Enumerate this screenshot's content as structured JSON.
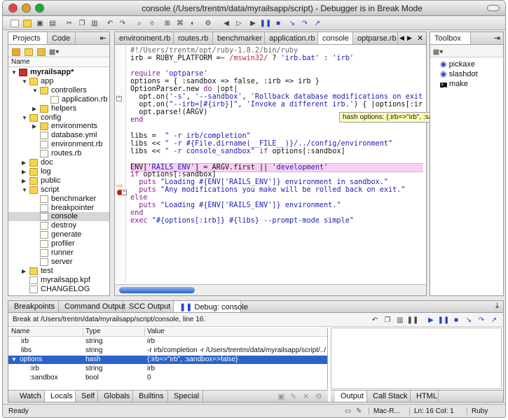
{
  "window": {
    "title": "console (/Users/trentm/data/myrailsapp/script) - Debugger is in Break Mode"
  },
  "colors": {
    "highlight_line": "#fbd0f5",
    "selection": "#2b63c9",
    "tooltip": "#ffffb8"
  },
  "left_panel": {
    "tabs": [
      "Projects",
      "Code"
    ],
    "column_header": "Name",
    "tree": [
      {
        "label": "myrailsapp*",
        "depth": 0,
        "type": "project",
        "expanded": true,
        "bold": true
      },
      {
        "label": "app",
        "depth": 1,
        "type": "folder",
        "expanded": true
      },
      {
        "label": "controllers",
        "depth": 2,
        "type": "folder",
        "expanded": true
      },
      {
        "label": "application.rb",
        "depth": 3,
        "type": "file"
      },
      {
        "label": "helpers",
        "depth": 2,
        "type": "folder",
        "expanded": false
      },
      {
        "label": "config",
        "depth": 1,
        "type": "folder",
        "expanded": true
      },
      {
        "label": "environments",
        "depth": 2,
        "type": "folder",
        "expanded": false
      },
      {
        "label": "database.yml",
        "depth": 2,
        "type": "file"
      },
      {
        "label": "environment.rb",
        "depth": 2,
        "type": "file"
      },
      {
        "label": "routes.rb",
        "depth": 2,
        "type": "file"
      },
      {
        "label": "doc",
        "depth": 1,
        "type": "folder",
        "expanded": false
      },
      {
        "label": "log",
        "depth": 1,
        "type": "folder",
        "expanded": false
      },
      {
        "label": "public",
        "depth": 1,
        "type": "folder",
        "expanded": false
      },
      {
        "label": "script",
        "depth": 1,
        "type": "folder",
        "expanded": true
      },
      {
        "label": "benchmarker",
        "depth": 2,
        "type": "file"
      },
      {
        "label": "breakpointer",
        "depth": 2,
        "type": "file"
      },
      {
        "label": "console",
        "depth": 2,
        "type": "file",
        "selected": true
      },
      {
        "label": "destroy",
        "depth": 2,
        "type": "file"
      },
      {
        "label": "generate",
        "depth": 2,
        "type": "file"
      },
      {
        "label": "profiler",
        "depth": 2,
        "type": "file"
      },
      {
        "label": "runner",
        "depth": 2,
        "type": "file"
      },
      {
        "label": "server",
        "depth": 2,
        "type": "file"
      },
      {
        "label": "test",
        "depth": 1,
        "type": "folder",
        "expanded": false
      },
      {
        "label": "myrailsapp.kpf",
        "depth": 1,
        "type": "file"
      },
      {
        "label": "CHANGELOG",
        "depth": 1,
        "type": "file"
      }
    ]
  },
  "editor": {
    "tabs": [
      "environment.rb",
      "routes.rb",
      "benchmarker",
      "application.rb",
      "console",
      "optparse.rb"
    ],
    "active_tab": "console",
    "tooltip": "hash options: {:irb=>\"irb\", :sandbox=>false}",
    "lines": [
      "#!/Users/trentm/opt/ruby-1.8.2/bin/ruby",
      "irb = RUBY_PLATFORM =~ /mswin32/ ? 'irb.bat' : 'irb'",
      "",
      "require 'optparse'",
      "options = { :sandbox => false, :irb => irb }",
      "OptionParser.new do |opt|",
      "  opt.on('-s', '--sandbox', 'Rollback database modifications on exit.') { |option",
      "  opt.on(\"--irb=[#{irb}]\", 'Invoke a different irb.') { |options[:irb]| }",
      "  opt.parse!(ARGV)",
      "end",
      "",
      "libs =  \" -r irb/completion\"",
      "libs << \" -r #{File.dirname(__FILE__)}/../config/environment\"",
      "libs << \" -r console_sandbox\" if options[:sandbox]",
      "",
      "ENV['RAILS_ENV'] = ARGV.first || 'development'",
      "if options[:sandbox]",
      "  puts \"Loading #{ENV['RAILS_ENV']} environment in sandbox.\"",
      "  puts \"Any modifications you make will be rolled back on exit.\"",
      "else",
      "  puts \"Loading #{ENV['RAILS_ENV']} environment.\"",
      "end",
      "exec \"#{options[:irb]} #{libs} --prompt-mode simple\""
    ]
  },
  "toolbox": {
    "title": "Toolbox",
    "items": [
      "pickaxe",
      "slashdot",
      "make"
    ]
  },
  "bottom": {
    "tabs": [
      "Breakpoints",
      "Command Output",
      "SCC Output",
      "Debug: console"
    ],
    "break_text": "Break at /Users/trentm/data/myrailsapp/script/console, line 16.",
    "columns": [
      "Name",
      "Type",
      "Value"
    ],
    "rows": [
      {
        "name": "irb",
        "type": "string",
        "value": "irb",
        "indent": 1
      },
      {
        "name": "libs",
        "type": "string",
        "value": "-r irb/completion -r /Users/trentm/data/myrailsapp/script/../...",
        "indent": 1
      },
      {
        "name": "options",
        "type": "hash",
        "value": "{:irb=>\"irb\", :sandbox=>false}",
        "indent": 0,
        "selected": true
      },
      {
        "name": ":irb",
        "type": "string",
        "value": "irb",
        "indent": 2
      },
      {
        "name": ":sandbox",
        "type": "bool",
        "value": "0",
        "indent": 2
      }
    ],
    "var_tabs": [
      "Watch",
      "Locals",
      "Self",
      "Globals",
      "Builtins",
      "Special"
    ],
    "active_var_tab": "Locals",
    "output_tabs": [
      "Output",
      "Call Stack",
      "HTML"
    ],
    "active_output_tab": "Output"
  },
  "statusbar": {
    "left": "Ready",
    "encoding": "Mac-R...",
    "position": "Ln: 16 Col: 1",
    "language": "Ruby"
  }
}
